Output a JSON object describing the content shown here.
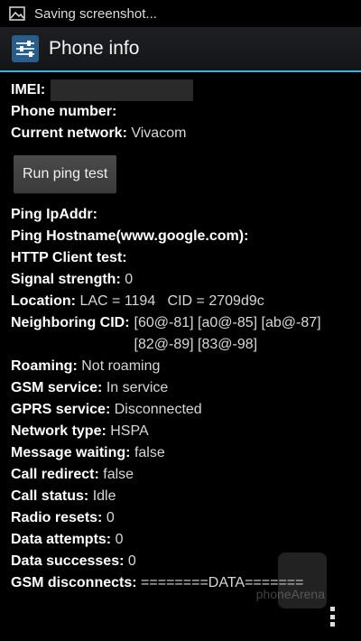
{
  "status_bar": {
    "text": "Saving screenshot..."
  },
  "header": {
    "title": "Phone info"
  },
  "info": {
    "imei_label": "IMEI:",
    "phone_number_label": "Phone number:",
    "current_network_label": "Current network:",
    "current_network_value": "Vivacom",
    "ping_button": "Run ping test",
    "ping_ipaddr_label": "Ping IpAddr:",
    "ping_hostname_label": "Ping Hostname(www.google.com):",
    "http_client_label": "HTTP Client test:",
    "signal_label": "Signal strength:",
    "signal_value": "0",
    "location_label": "Location:",
    "location_value": "LAC = 1194   CID = 2709d9c",
    "neighboring_label": "Neighboring CID:",
    "neighboring_line1": "[60@-81] [a0@-85] [ab@-87]",
    "neighboring_line2": "[82@-89] [83@-98]",
    "roaming_label": "Roaming:",
    "roaming_value": "Not roaming",
    "gsm_service_label": "GSM service:",
    "gsm_service_value": "In service",
    "gprs_service_label": "GPRS service:",
    "gprs_service_value": "Disconnected",
    "network_type_label": "Network type:",
    "network_type_value": "HSPA",
    "message_waiting_label": "Message waiting:",
    "message_waiting_value": "false",
    "call_redirect_label": "Call redirect:",
    "call_redirect_value": "false",
    "call_status_label": "Call status:",
    "call_status_value": "Idle",
    "radio_resets_label": "Radio resets:",
    "radio_resets_value": "0",
    "data_attempts_label": "Data attempts:",
    "data_attempts_value": "0",
    "data_successes_label": "Data successes:",
    "data_successes_value": "0",
    "gsm_disconnects_label": "GSM disconnects:",
    "gsm_disconnects_value": "========DATA======="
  },
  "watermark": {
    "text": "phoneArena"
  },
  "colors": {
    "accent": "#33b5e5",
    "background": "#000000"
  },
  "icons": {
    "status": "image-icon",
    "app": "settings-sliders-icon",
    "overflow": "overflow-menu-icon"
  }
}
